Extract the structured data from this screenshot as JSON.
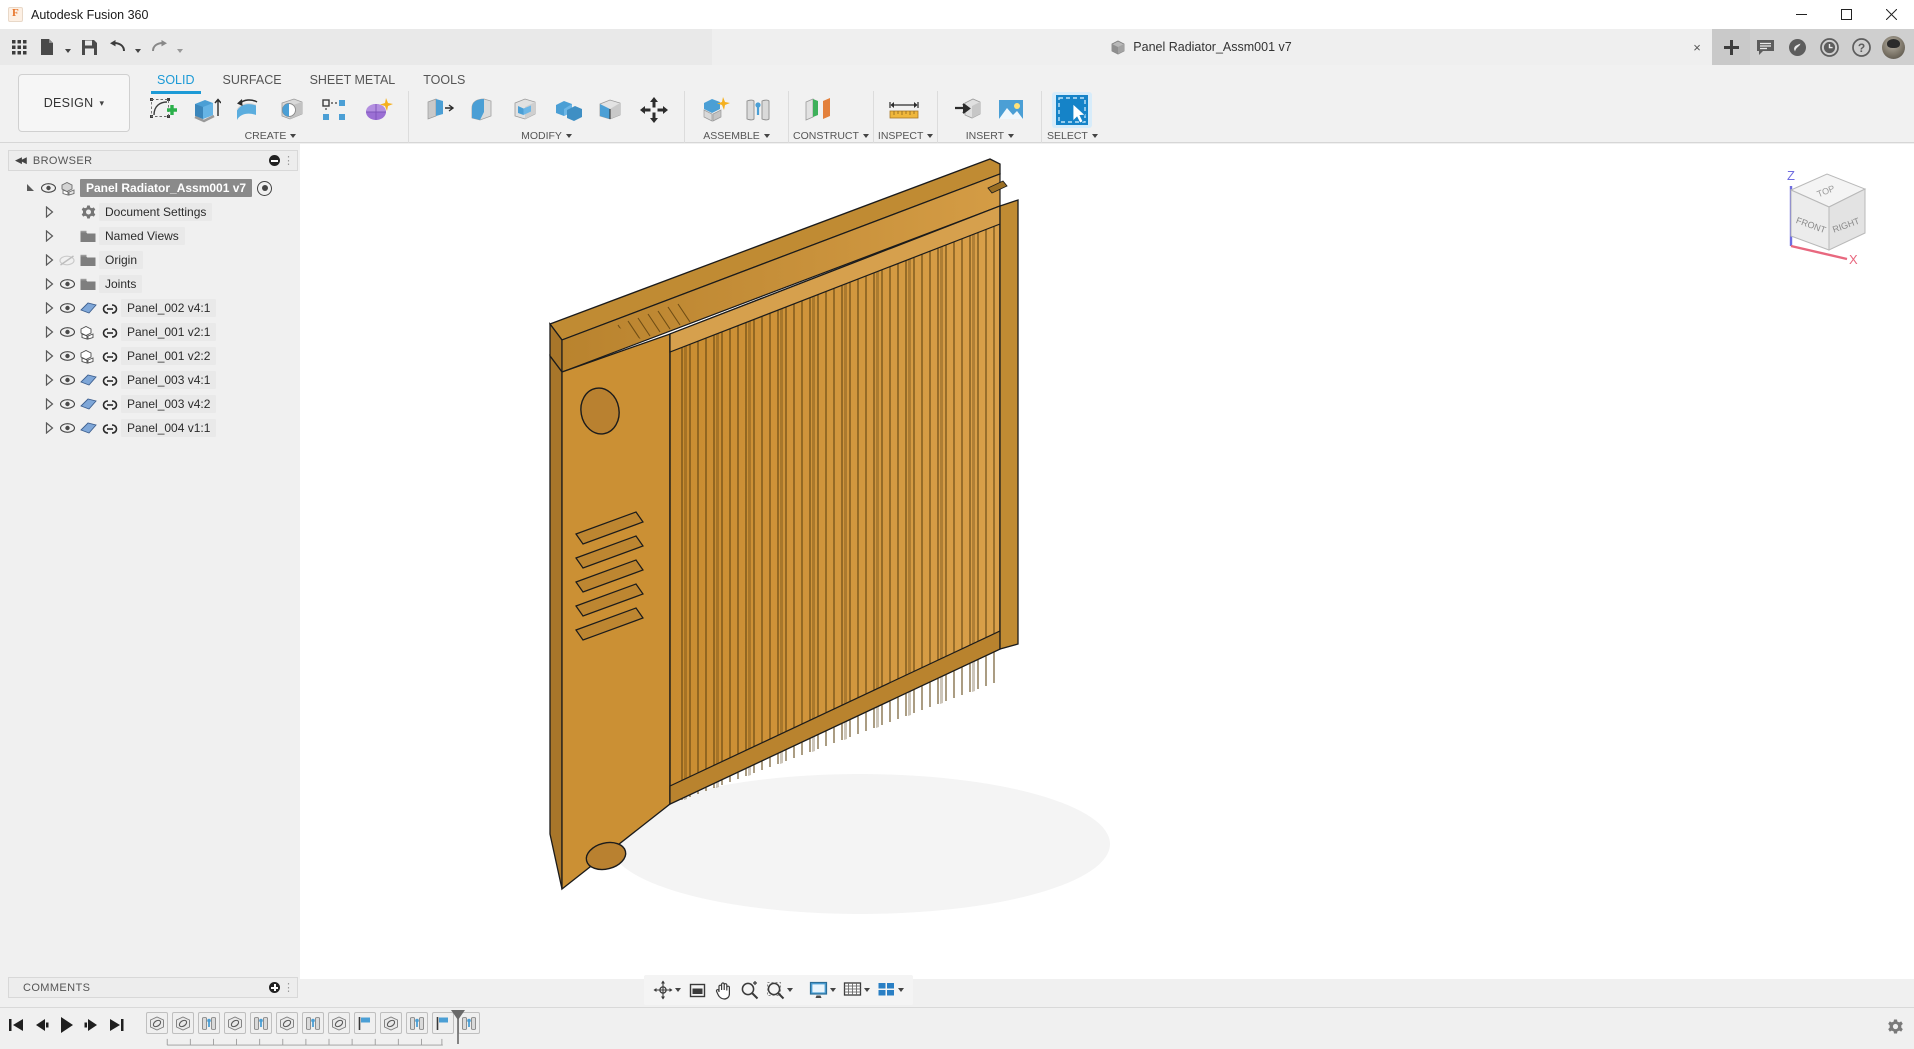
{
  "app": {
    "title": "Autodesk Fusion 360",
    "logo_icon": "fusion-logo-icon"
  },
  "window_controls": {
    "minimize": "minimize-icon",
    "maximize": "maximize-icon",
    "close": "close-icon"
  },
  "quick_access": {
    "items": [
      {
        "name": "app-grid-button",
        "icon": "grid-icon",
        "caret": false
      },
      {
        "name": "new-file-button",
        "icon": "file-icon",
        "caret": true
      },
      {
        "name": "save-button",
        "icon": "save-icon",
        "caret": false
      },
      {
        "name": "undo-button",
        "icon": "undo-icon",
        "caret": true
      },
      {
        "name": "redo-button",
        "icon": "redo-icon",
        "caret": true
      }
    ],
    "right_items": [
      {
        "name": "comments-panel-button",
        "icon": "comment-icon"
      },
      {
        "name": "extensions-button",
        "icon": "extension-icon"
      },
      {
        "name": "recent-activity-button",
        "icon": "clock-icon"
      },
      {
        "name": "help-button",
        "icon": "help-icon"
      }
    ],
    "avatar": "user-avatar"
  },
  "document_tab": {
    "label": "Panel Radiator_Assm001 v7",
    "icon": "document-cube-icon",
    "close_label": "×",
    "new_tab_label": "+"
  },
  "ribbon": {
    "workspace": {
      "label": "DESIGN",
      "caret": "▾"
    },
    "tabs": [
      {
        "label": "SOLID",
        "active": true
      },
      {
        "label": "SURFACE",
        "active": false
      },
      {
        "label": "SHEET METAL",
        "active": false
      },
      {
        "label": "TOOLS",
        "active": false
      }
    ],
    "panels": [
      {
        "title": "CREATE",
        "has_caret": true,
        "tools": [
          {
            "name": "create-sketch-tool",
            "icon": "sketch-plus-icon"
          },
          {
            "name": "extrude-tool",
            "icon": "extrude-icon"
          },
          {
            "name": "revolve-tool",
            "icon": "revolve-icon"
          },
          {
            "name": "hole-tool",
            "icon": "hole-icon"
          },
          {
            "name": "pattern-tool",
            "icon": "rect-pattern-icon"
          },
          {
            "name": "create-form-tool",
            "icon": "form-sphere-icon"
          }
        ]
      },
      {
        "title": "MODIFY",
        "has_caret": true,
        "tools": [
          {
            "name": "press-pull-tool",
            "icon": "press-pull-icon"
          },
          {
            "name": "fillet-tool",
            "icon": "fillet-icon"
          },
          {
            "name": "shell-tool",
            "icon": "shell-icon"
          },
          {
            "name": "combine-tool",
            "icon": "combine-icon"
          },
          {
            "name": "split-face-tool",
            "icon": "split-face-icon"
          },
          {
            "name": "move-copy-tool",
            "icon": "move-arrows-icon"
          }
        ]
      },
      {
        "title": "ASSEMBLE",
        "has_caret": true,
        "tools": [
          {
            "name": "new-component-tool",
            "icon": "new-component-icon"
          },
          {
            "name": "joint-tool",
            "icon": "joint-icon"
          }
        ]
      },
      {
        "title": "CONSTRUCT",
        "has_caret": true,
        "tools": [
          {
            "name": "offset-plane-tool",
            "icon": "offset-plane-icon"
          }
        ]
      },
      {
        "title": "INSPECT",
        "has_caret": true,
        "tools": [
          {
            "name": "measure-tool",
            "icon": "measure-ruler-icon"
          }
        ]
      },
      {
        "title": "INSERT",
        "has_caret": true,
        "tools": [
          {
            "name": "insert-derive-tool",
            "icon": "insert-derive-icon"
          },
          {
            "name": "decal-tool",
            "icon": "image-decal-icon"
          }
        ]
      },
      {
        "title": "SELECT",
        "has_caret": true,
        "tools": [
          {
            "name": "select-tool",
            "icon": "select-window-cursor-icon"
          }
        ]
      }
    ]
  },
  "browser": {
    "header_label": "BROWSER",
    "collapse_icon": "collapse-left-icon",
    "minus_icon": "circle-minus-icon",
    "grip_icon": "resize-grip-icon",
    "nodes": [
      {
        "label": "Panel Radiator_Assm001 v7",
        "icon": "assembly-icon",
        "indent": 0,
        "selected": true,
        "expanded": true,
        "eye": true,
        "eye_dim": false,
        "link": false,
        "has_dot": true
      },
      {
        "label": "Document Settings",
        "icon": "gear-icon",
        "indent": 1,
        "selected": false,
        "expanded": false,
        "eye": false,
        "eye_dim": false,
        "link": false,
        "has_dot": false
      },
      {
        "label": "Named Views",
        "icon": "folder-icon",
        "indent": 1,
        "selected": false,
        "expanded": false,
        "eye": false,
        "eye_dim": false,
        "link": false,
        "has_dot": false
      },
      {
        "label": "Origin",
        "icon": "folder-icon",
        "indent": 1,
        "selected": false,
        "expanded": false,
        "eye": true,
        "eye_dim": true,
        "link": false,
        "has_dot": false
      },
      {
        "label": "Joints",
        "icon": "folder-icon",
        "indent": 1,
        "selected": false,
        "expanded": false,
        "eye": true,
        "eye_dim": false,
        "link": false,
        "has_dot": false
      },
      {
        "label": "Panel_002 v4:1",
        "icon": "sheetmetal-icon",
        "indent": 1,
        "selected": false,
        "expanded": false,
        "eye": true,
        "eye_dim": false,
        "link": true,
        "has_dot": false
      },
      {
        "label": "Panel_001 v2:1",
        "icon": "component-icon",
        "indent": 1,
        "selected": false,
        "expanded": false,
        "eye": true,
        "eye_dim": false,
        "link": true,
        "has_dot": false
      },
      {
        "label": "Panel_001 v2:2",
        "icon": "component-icon",
        "indent": 1,
        "selected": false,
        "expanded": false,
        "eye": true,
        "eye_dim": false,
        "link": true,
        "has_dot": false
      },
      {
        "label": "Panel_003 v4:1",
        "icon": "sheetmetal-icon",
        "indent": 1,
        "selected": false,
        "expanded": false,
        "eye": true,
        "eye_dim": false,
        "link": true,
        "has_dot": false
      },
      {
        "label": "Panel_003 v4:2",
        "icon": "sheetmetal-icon",
        "indent": 1,
        "selected": false,
        "expanded": false,
        "eye": true,
        "eye_dim": false,
        "link": true,
        "has_dot": false
      },
      {
        "label": "Panel_004 v1:1",
        "icon": "sheetmetal-icon",
        "indent": 1,
        "selected": false,
        "expanded": false,
        "eye": true,
        "eye_dim": false,
        "link": true,
        "has_dot": false
      }
    ]
  },
  "comments": {
    "label": "COMMENTS",
    "add_icon": "circle-plus-icon",
    "grip_icon": "resize-grip-icon"
  },
  "viewcube": {
    "top_label": "TOP",
    "front_label": "FRONT",
    "right_label": "RIGHT",
    "axis_x": "X",
    "axis_z": "Z",
    "axis_x_color": "#e8687f",
    "axis_z_color": "#6f6ce0"
  },
  "nav_bar": {
    "items": [
      {
        "name": "orbit-button",
        "icon": "orbit-icon",
        "caret": true
      },
      {
        "name": "view-fit-button",
        "icon": "fit-view-icon",
        "caret": false
      },
      {
        "name": "pan-button",
        "icon": "pan-hand-icon",
        "caret": false
      },
      {
        "name": "zoom-button",
        "icon": "zoom-plus-icon",
        "caret": false
      },
      {
        "name": "zoom-window-button",
        "icon": "zoom-window-icon",
        "caret": true
      },
      {
        "name": "display-settings-button",
        "icon": "monitor-icon",
        "caret": true
      },
      {
        "name": "grid-snaps-button",
        "icon": "grid-snap-icon",
        "caret": true
      },
      {
        "name": "viewports-button",
        "icon": "viewports-icon",
        "caret": true
      }
    ]
  },
  "timeline": {
    "controls": [
      {
        "name": "timeline-go-start",
        "icon": "skip-start-icon"
      },
      {
        "name": "timeline-step-back",
        "icon": "step-back-icon"
      },
      {
        "name": "timeline-play",
        "icon": "play-icon"
      },
      {
        "name": "timeline-step-forward",
        "icon": "step-forward-icon"
      },
      {
        "name": "timeline-go-end",
        "icon": "skip-end-icon"
      }
    ],
    "features": [
      {
        "name": "timeline-feature",
        "icon": "joint-revolve-icon",
        "type": "revolve"
      },
      {
        "name": "timeline-feature",
        "icon": "joint-revolve-icon",
        "type": "revolve"
      },
      {
        "name": "timeline-feature",
        "icon": "joint-rigid-icon",
        "type": "joint"
      },
      {
        "name": "timeline-feature",
        "icon": "joint-revolve-icon",
        "type": "revolve"
      },
      {
        "name": "timeline-feature",
        "icon": "joint-rigid-icon",
        "type": "joint"
      },
      {
        "name": "timeline-feature",
        "icon": "joint-revolve-icon",
        "type": "revolve"
      },
      {
        "name": "timeline-feature",
        "icon": "joint-rigid-icon",
        "type": "joint"
      },
      {
        "name": "timeline-feature",
        "icon": "joint-revolve-icon",
        "type": "revolve"
      },
      {
        "name": "timeline-feature",
        "icon": "flag-blue-icon",
        "type": "flag"
      },
      {
        "name": "timeline-feature",
        "icon": "joint-revolve-icon",
        "type": "revolve"
      },
      {
        "name": "timeline-feature",
        "icon": "joint-rigid-icon",
        "type": "joint"
      },
      {
        "name": "timeline-feature",
        "icon": "flag-blue-icon",
        "type": "flag"
      },
      {
        "name": "timeline-feature",
        "icon": "joint-rigid-icon",
        "type": "joint"
      }
    ],
    "marker_icon": "timeline-end-marker-icon",
    "settings_icon": "gear-icon"
  },
  "model": {
    "name": "panel-radiator-3d-model",
    "body_color": "#cf9236",
    "body_color_dark": "#a8762a",
    "body_color_light": "#dba752",
    "edge_color": "#1b1b1b",
    "fin_count": 44,
    "side_slot_count": 5
  },
  "colors": {
    "accent": "#1c9ad6",
    "ribbon_bg": "#f1f1f1",
    "titlebar_bg": "#ffffff",
    "canvas_bg": "#ffffff"
  }
}
